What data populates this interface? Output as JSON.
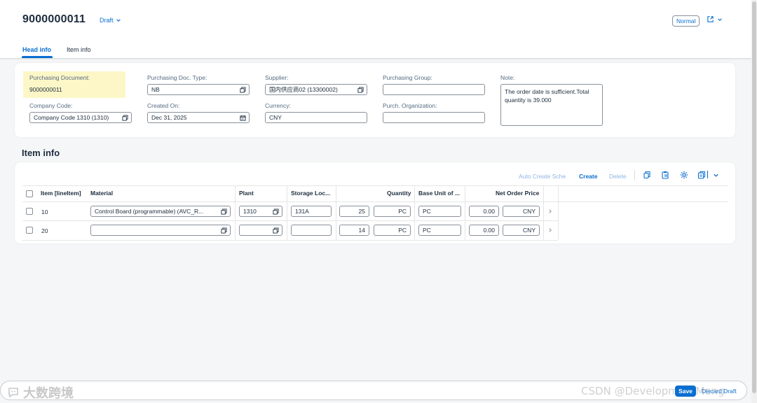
{
  "header": {
    "document_number": "9000000011",
    "status": "Draft",
    "view_mode": "Normal",
    "tabs": [
      {
        "label": "Head info"
      },
      {
        "label": "Item info"
      }
    ]
  },
  "head_info": {
    "purchasing_document": {
      "label": "Purchasing Document:",
      "value": "9000000011"
    },
    "company_code": {
      "label": "Company Code:",
      "value": "Company Code 1310 (1310)"
    },
    "purchasing_doc_type": {
      "label": "Purchasing Doc. Type:",
      "value": "NB"
    },
    "created_on": {
      "label": "Created On:",
      "value": "Dec 31, 2025"
    },
    "supplier": {
      "label": "Supplier:",
      "value": "国内供应商02 (13300002)"
    },
    "currency": {
      "label": "Currency:",
      "value": "CNY"
    },
    "purchasing_group": {
      "label": "Purchasing Group:",
      "value": ""
    },
    "purch_organization": {
      "label": "Purch. Organization:",
      "value": ""
    },
    "note": {
      "label": "Note:",
      "value": "The order date is sufficient.Total quantity is 39.000"
    }
  },
  "item_info": {
    "title": "Item info",
    "toolbar": {
      "auto_create": "Auto Create Sche",
      "create": "Create",
      "delete": "Delete"
    },
    "columns": [
      "Item [lineItem]",
      "Material",
      "Plant",
      "Storage Loc...",
      "Quantity",
      "Base Unit of ...",
      "Net Order Price"
    ],
    "rows": [
      {
        "item": "10",
        "material": "Control Board (programmable) (AVC_R...",
        "plant": "1310",
        "storage_loc": "131A",
        "quantity": "25",
        "unit": "PC",
        "base_unit": "PC",
        "price": "0.00",
        "currency": "CNY"
      },
      {
        "item": "20",
        "material": "",
        "plant": "",
        "storage_loc": "",
        "quantity": "14",
        "unit": "PC",
        "base_unit": "PC",
        "price": "0.00",
        "currency": "CNY"
      }
    ]
  },
  "footer": {
    "save": "Save",
    "discard": "Discard Draft",
    "watermark_left": "大数跨境",
    "watermark_right": "CSDN @DevelopmentMeng"
  },
  "colors": {
    "accent": "#0a6ed1",
    "highlight": "#fdf7c8",
    "text": "#1d2d3e",
    "label": "#556b82"
  }
}
